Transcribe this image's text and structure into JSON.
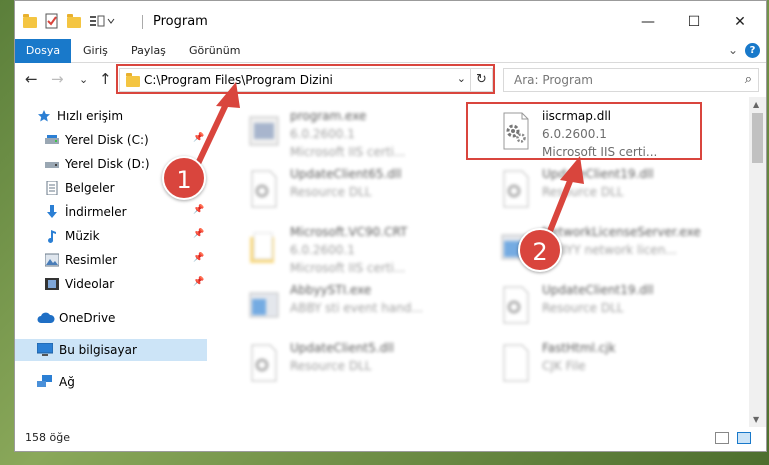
{
  "window": {
    "title": "Program",
    "controls": {
      "minimize": "—",
      "maximize": "☐",
      "close": "✕"
    }
  },
  "ribbon": {
    "tabs": [
      "Dosya",
      "Giriş",
      "Paylaş",
      "Görünüm"
    ],
    "expand": "⌄",
    "help": "?"
  },
  "nav": {
    "back": "←",
    "forward": "→",
    "recent": "⌄",
    "up": "↑",
    "address": "C:\\Program Files\\Program Dizini",
    "address_chevron": "⌄",
    "refresh": "↻",
    "search_placeholder": "Ara: Program",
    "search_icon": "⌕"
  },
  "sidebar": {
    "items": [
      {
        "label": "Hızlı erişim",
        "icon": "star-icon"
      },
      {
        "label": "Yerel Disk (C:)",
        "icon": "drive-icon"
      },
      {
        "label": "Yerel Disk (D:)",
        "icon": "drive-icon"
      },
      {
        "label": "Belgeler",
        "icon": "document-icon"
      },
      {
        "label": "İndirmeler",
        "icon": "download-icon"
      },
      {
        "label": "Müzik",
        "icon": "music-icon"
      },
      {
        "label": "Resimler",
        "icon": "pictures-icon"
      },
      {
        "label": "Videolar",
        "icon": "video-icon"
      },
      {
        "label": "OneDrive",
        "icon": "cloud-icon"
      },
      {
        "label": "Bu bilgisayar",
        "icon": "computer-icon"
      },
      {
        "label": "Ağ",
        "icon": "network-icon"
      }
    ]
  },
  "files": [
    {
      "name": "program.exe",
      "l2": "6.0.2600.1",
      "l3": "Microsoft IIS certi..."
    },
    {
      "name": "iiscrmap.dll",
      "l2": "6.0.2600.1",
      "l3": "Microsoft IIS certi..."
    },
    {
      "name": "UpdateClient65.dll",
      "l2": "Resource DLL",
      "l3": ""
    },
    {
      "name": "UpdateClient19.dll",
      "l2": "Resource DLL",
      "l3": ""
    },
    {
      "name": "Microsoft.VC90.CRT",
      "l2": "6.0.2600.1",
      "l3": "Microsoft IIS certi..."
    },
    {
      "name": "NetworkLicenseServer.exe",
      "l2": "ABBYY network licen...",
      "l3": ""
    },
    {
      "name": "AbbyySTI.exe",
      "l2": "ABBY sti event hand...",
      "l3": ""
    },
    {
      "name": "UpdateClient19.dll",
      "l2": "Resource DLL",
      "l3": ""
    },
    {
      "name": "UpdateClient5.dll",
      "l2": "Resource DLL",
      "l3": ""
    },
    {
      "name": "FastHtml.cjk",
      "l2": "CJK File",
      "l3": ""
    }
  ],
  "status": {
    "count": "158 öğe"
  },
  "annotations": {
    "step1": "1",
    "step2": "2",
    "color": "#d9453d"
  }
}
